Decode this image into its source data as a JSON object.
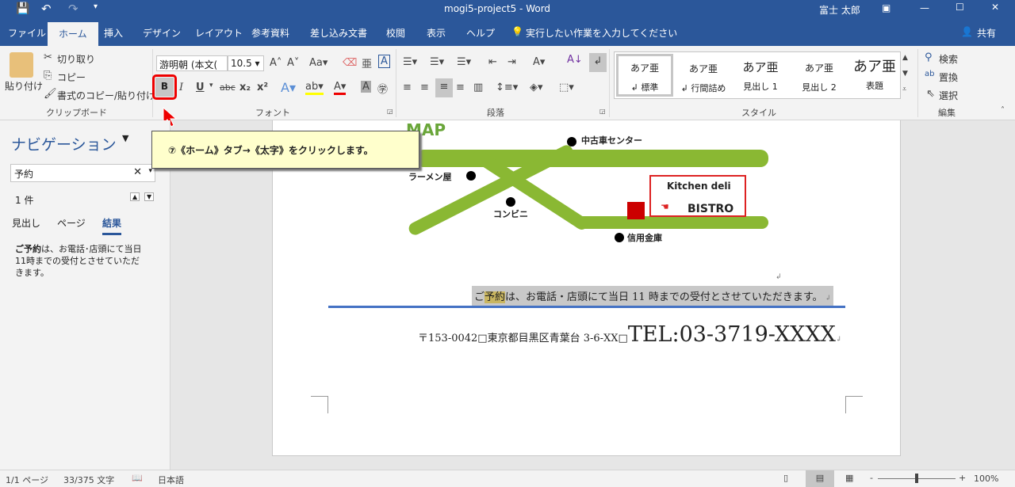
{
  "titlebar": {
    "title": "mogi5-project5  -  Word",
    "user": "富士 太郎"
  },
  "tabs": [
    "ファイル",
    "ホーム",
    "挿入",
    "デザイン",
    "レイアウト",
    "参考資料",
    "差し込み文書",
    "校閲",
    "表示",
    "ヘルプ"
  ],
  "tell_me": "実行したい作業を入力してください",
  "share": "共有",
  "clipboard": {
    "paste": "貼り付け",
    "cut": "切り取り",
    "copy": "コピー",
    "format_painter": "書式のコピー/貼り付け",
    "group": "クリップボード"
  },
  "font": {
    "name": "游明朝 (本文(",
    "size": "10.5",
    "group": "フォント",
    "bold": "B",
    "italic": "I",
    "underline": "U"
  },
  "paragraph": {
    "group": "段落"
  },
  "styles": {
    "group": "スタイル",
    "items": [
      {
        "preview": "あア亜",
        "label": "↲ 標準"
      },
      {
        "preview": "あア亜",
        "label": "↲ 行間詰め"
      },
      {
        "preview": "あア亜",
        "label": "見出し 1"
      },
      {
        "preview": "あア亜",
        "label": "見出し 2"
      },
      {
        "preview": "あア亜",
        "label": "表題"
      }
    ]
  },
  "editing": {
    "find": "検索",
    "replace": "置換",
    "select": "選択",
    "group": "編集"
  },
  "tooltip": "⑦《ホーム》タブ→《太字》をクリックします。",
  "nav": {
    "title": "ナビゲーション",
    "search": "予約",
    "count": "1 件",
    "tabs": [
      "見出し",
      "ページ",
      "結果"
    ],
    "result_bold": "ご予約",
    "result_rest": "は、お電話･店頭にて当日11時までの受付とさせていただきます。"
  },
  "map": {
    "title": "MAP",
    "labels": [
      "中古車センター",
      "ラーメン屋",
      "コンビニ",
      "信用金庫"
    ],
    "shop1": "Kitchen deli",
    "shop2": "BISTRO"
  },
  "doc": {
    "line1_pre": "ご",
    "line1_hl": "予約",
    "line1_post": "は、お電話・店頭にて当日 11 時までの受付とさせていただきます。",
    "address": "〒153-0042□東京都目黒区青葉台 3-6-XX□",
    "tel": "TEL:03-3719-XXXX"
  },
  "status": {
    "page": "1/1 ページ",
    "words": "33/375 文字",
    "lang": "日本語",
    "zoom": "100%",
    "zoom_level": 100
  },
  "colors": {
    "accent": "#2b579a",
    "road": "#8ab833",
    "highlight": "#c8b560"
  }
}
